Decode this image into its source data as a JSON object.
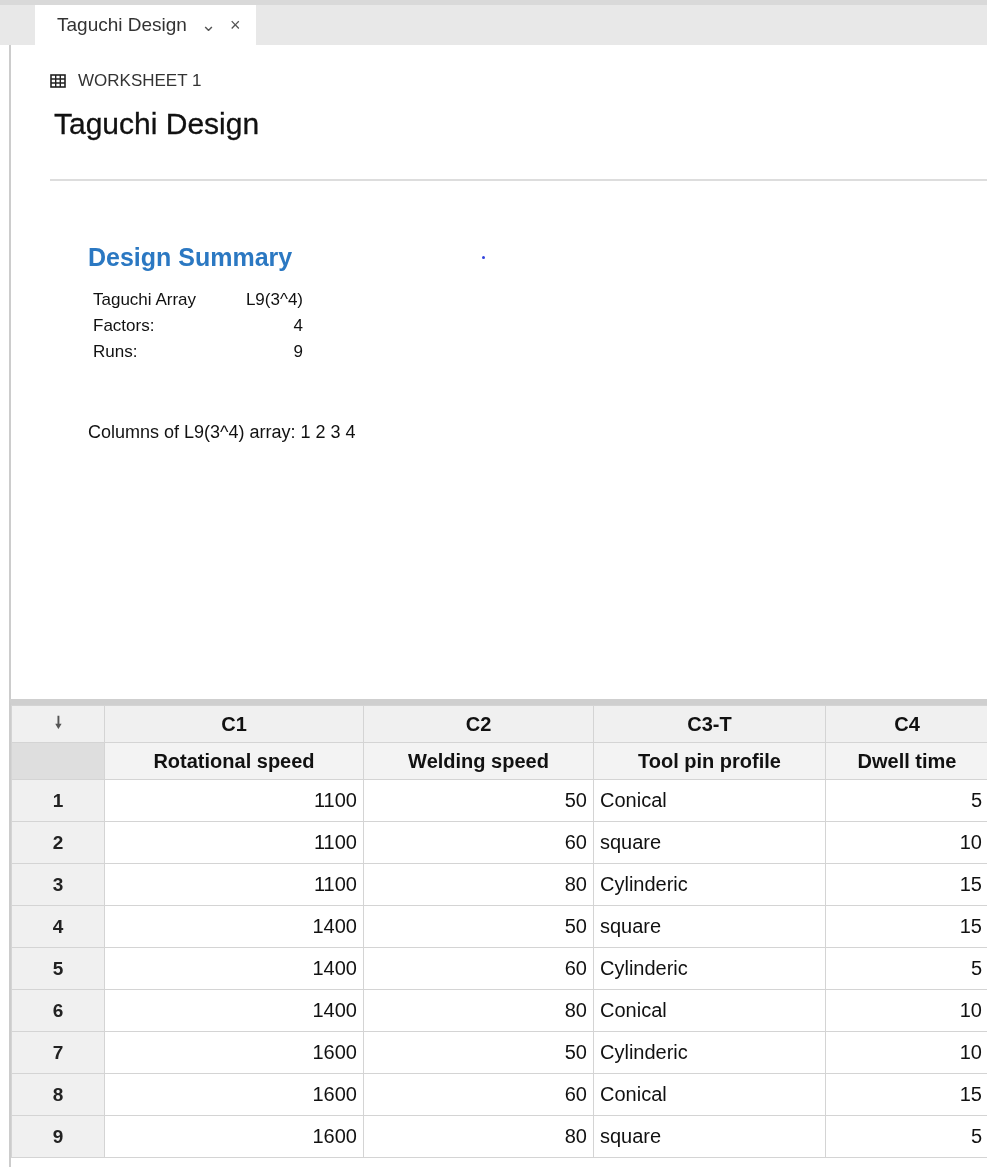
{
  "tab": {
    "label": "Taguchi Design",
    "dropdown": "⌄",
    "close": "×",
    "selected": true
  },
  "worksheet": {
    "label": "WORKSHEET 1"
  },
  "title": "Taguchi Design",
  "summary": {
    "heading": "Design Summary",
    "rows": [
      {
        "label": "Taguchi Array",
        "value": "L9(3^4)"
      },
      {
        "label": "Factors:",
        "value": "4"
      },
      {
        "label": "Runs:",
        "value": "9"
      }
    ],
    "note": "Columns of L9(3^4) array: 1 2 3 4"
  },
  "table": {
    "corner": "🠗",
    "columns": [
      {
        "id": "C1",
        "name": "Rotational speed",
        "kind": "numeric"
      },
      {
        "id": "C2",
        "name": "Welding speed",
        "kind": "numeric"
      },
      {
        "id": "C3-T",
        "name": "Tool pin profile",
        "kind": "text"
      },
      {
        "id": "C4",
        "name": "Dwell time",
        "kind": "numeric"
      }
    ],
    "rows": [
      {
        "index": "1",
        "cells": [
          "1100",
          "50",
          "Conical",
          "5"
        ]
      },
      {
        "index": "2",
        "cells": [
          "1100",
          "60",
          "square",
          "10"
        ]
      },
      {
        "index": "3",
        "cells": [
          "1100",
          "80",
          "Cylinderic",
          "15"
        ]
      },
      {
        "index": "4",
        "cells": [
          "1400",
          "50",
          "square",
          "15"
        ]
      },
      {
        "index": "5",
        "cells": [
          "1400",
          "60",
          "Cylinderic",
          "5"
        ]
      },
      {
        "index": "6",
        "cells": [
          "1400",
          "80",
          "Conical",
          "10"
        ]
      },
      {
        "index": "7",
        "cells": [
          "1600",
          "50",
          "Cylinderic",
          "10"
        ]
      },
      {
        "index": "8",
        "cells": [
          "1600",
          "60",
          "Conical",
          "15"
        ]
      },
      {
        "index": "9",
        "cells": [
          "1600",
          "80",
          "square",
          "5"
        ]
      }
    ]
  }
}
